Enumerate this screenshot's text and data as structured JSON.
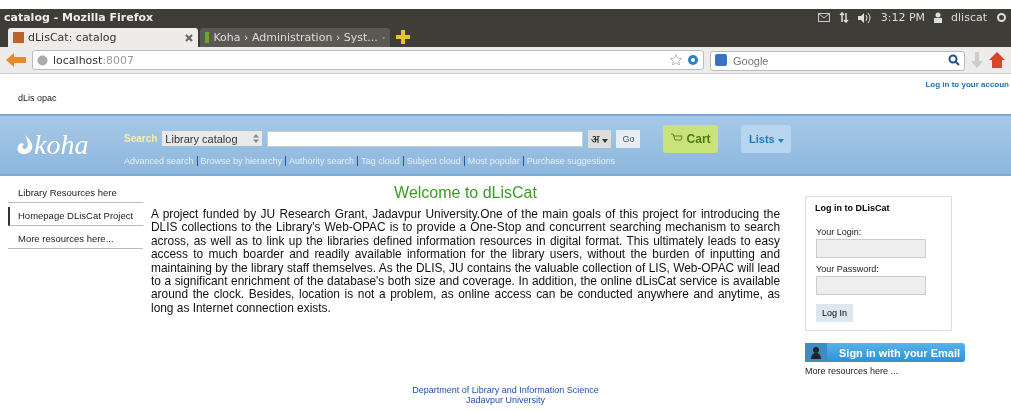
{
  "window": {
    "title": "catalog - Mozilla Firefox"
  },
  "tray": {
    "time": "3:12 PM",
    "user": "dliscat"
  },
  "tabs": [
    {
      "label": "dLisCat: catalog",
      "selected": true
    },
    {
      "label": "Koha › Administration › Syst...",
      "selected": false
    }
  ],
  "address_bar": {
    "host": "localhost",
    "port": ":8007"
  },
  "web_search": {
    "placeholder": "Google"
  },
  "page": {
    "site_name": "dLis opac",
    "account_link": "Log in to your accoun",
    "logo": "koha",
    "search": {
      "label": "Search",
      "scope": "Library catalog",
      "script_key": "अ",
      "go": "Go",
      "cart": "Cart",
      "lists": "Lists"
    },
    "links": [
      "Advanced search",
      "Browse by hierarchy",
      "Authority search",
      "Tag cloud",
      "Subject cloud",
      "Most popular",
      "Purchase suggestions"
    ],
    "sidebar": [
      {
        "label": "Library Resources here",
        "selected": false
      },
      {
        "label": "Homepage DLisCat Project",
        "selected": true
      },
      {
        "label": "More resources here...",
        "selected": false
      }
    ],
    "heading": "Welcome to dLisCat",
    "body": "A project funded by JU Research Grant, Jadavpur University.One of the main goals of this project for introducing the DLIS collections to the Library's Web-OPAC is to provide a One-Stop and concurrent searching mechanism to search across, as well as to link up the libraries defined information resources in digital format. This ultimately leads to easy access to much boarder and readily available information for the library users, without the burden of inputting and maintaining by the library staff themselves. As the DLIS, JU contains the valuable collection of LIS, Web-OPAC will lead to a significant enrichment of the database's both size and coverage. In addition, the online dLisCat service is available around the clock. Besides, location is not a problem, as online access can be conducted anywhere and anytime, as long as Internet connection exists.",
    "login": {
      "title": "Log in to DLisCat",
      "login_label": "Your Login:",
      "password_label": "Your Password:",
      "button": "Log In"
    },
    "email_button": "Sign in with your Email",
    "more_resources": "More resources here ...",
    "footer": [
      "Department of Library and Information Science",
      "Jadavpur University"
    ]
  }
}
